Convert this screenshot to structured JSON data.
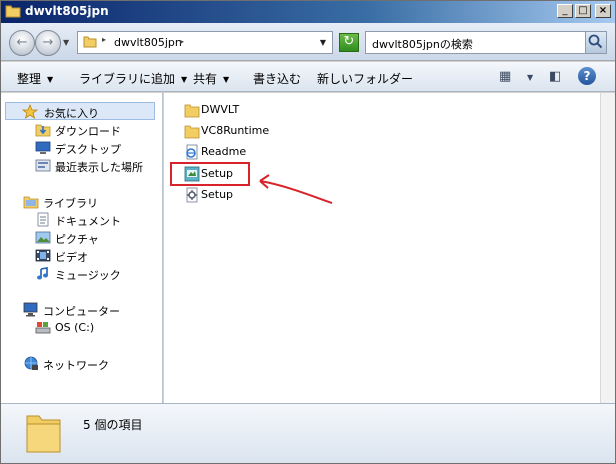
{
  "window": {
    "title": "dwvlt805jpn",
    "minimize_glyph": "_",
    "maximize_glyph": "□",
    "close_glyph": "×"
  },
  "address": {
    "path_segment": "dwvlt805jpn",
    "back_glyph": "←",
    "forward_glyph": "→",
    "dropdown_glyph": "▼",
    "separator_glyph": "▸",
    "refresh_glyph": "↻",
    "search_placeholder": "dwvlt805jpnの検索"
  },
  "toolbar": {
    "organize": "整理",
    "add_to_library": "ライブラリに追加",
    "share": "共有",
    "burn": "書き込む",
    "new_folder": "新しいフォルダー",
    "arrow_glyph": "▼",
    "view_icon_glyph": "▦",
    "preview_icon_glyph": "◧",
    "help_glyph": "?"
  },
  "sidebar": {
    "favorites": {
      "label": "お気に入り",
      "items": [
        "ダウンロード",
        "デスクトップ",
        "最近表示した場所"
      ]
    },
    "libraries": {
      "label": "ライブラリ",
      "items": [
        "ドキュメント",
        "ピクチャ",
        "ビデオ",
        "ミュージック"
      ]
    },
    "computer": {
      "label": "コンピューター",
      "items": [
        "OS (C:)"
      ]
    },
    "network": {
      "label": "ネットワーク"
    }
  },
  "files": [
    {
      "name": "DWVLT",
      "icon": "folder-icon"
    },
    {
      "name": "VC8Runtime",
      "icon": "folder-icon"
    },
    {
      "name": "Readme",
      "icon": "html-document-icon"
    },
    {
      "name": "Setup",
      "icon": "installer-icon"
    },
    {
      "name": "Setup",
      "icon": "settings-file-icon"
    }
  ],
  "status": {
    "item_count": "5 個の項目"
  },
  "colors": {
    "annotation_red": "#d8232a",
    "folder_yellow": "#f2cd63",
    "selection_blue": "#dce8f7"
  }
}
